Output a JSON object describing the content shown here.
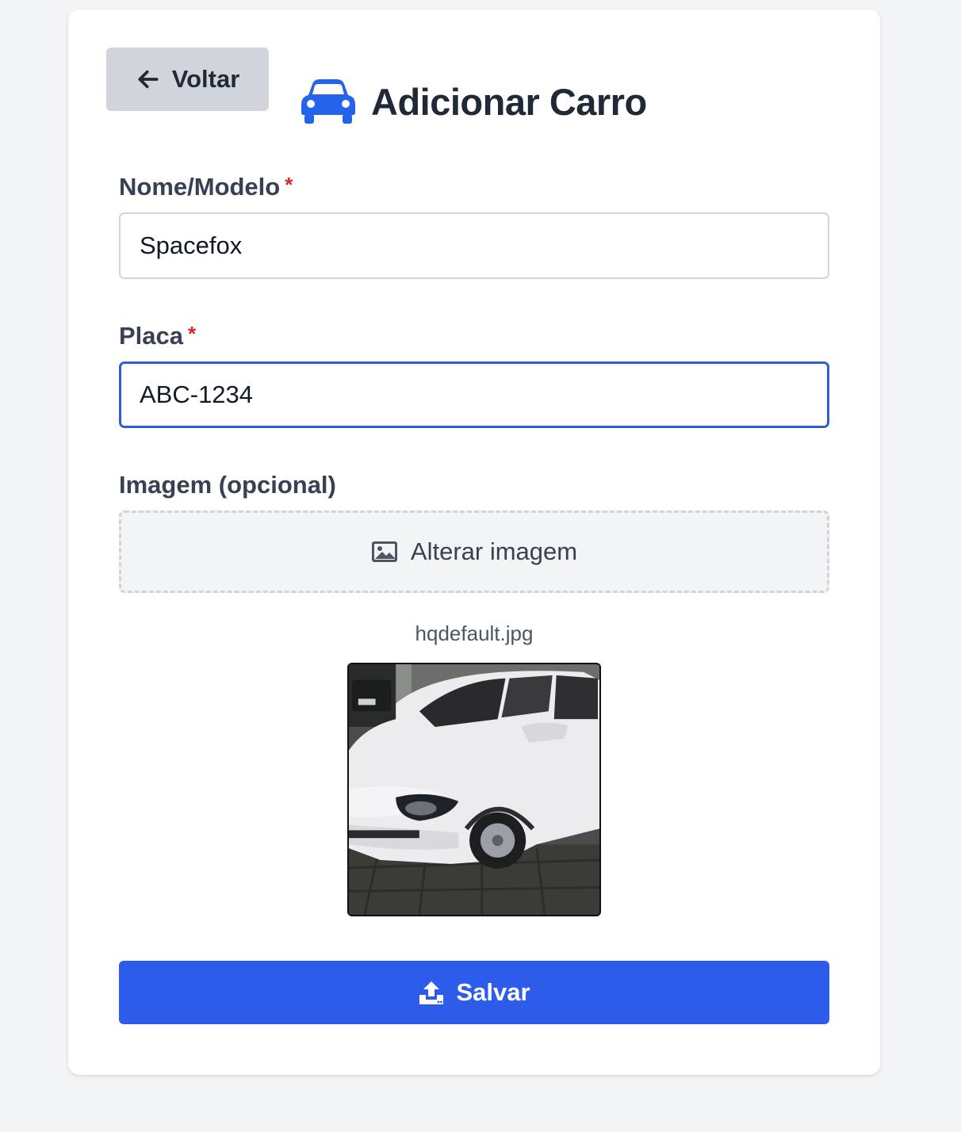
{
  "header": {
    "back_label": "Voltar",
    "title": "Adicionar Carro"
  },
  "form": {
    "name_label": "Nome/Modelo",
    "name_required_mark": "*",
    "name_value": "Spacefox",
    "plate_label": "Placa",
    "plate_required_mark": "*",
    "plate_value": "ABC-1234",
    "image_label": "Imagem (opcional)",
    "image_button_label": "Alterar imagem",
    "file_name": "hqdefault.jpg",
    "save_label": "Salvar"
  },
  "icons": {
    "back": "arrow-left-icon",
    "title": "car-icon",
    "image": "image-icon",
    "save": "upload-icon"
  },
  "colors": {
    "accent": "#2d5ceb",
    "title_icon": "#2563eb",
    "required": "#dc2626",
    "focus_border": "#2d5fd3"
  }
}
